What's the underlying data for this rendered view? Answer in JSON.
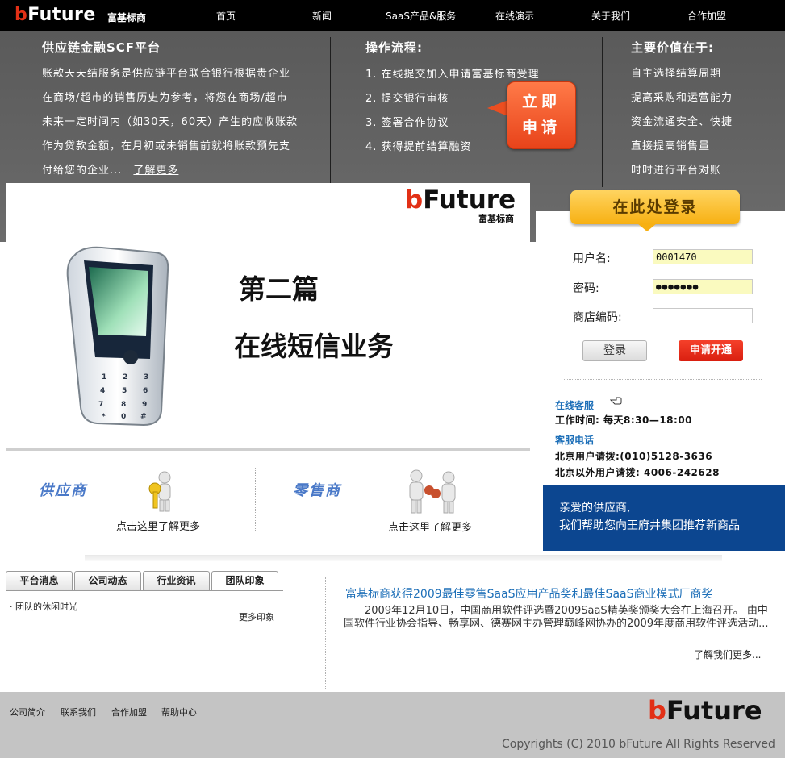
{
  "header": {
    "logo_b": "b",
    "logo_rest": "Future",
    "logo_cn": "富基标商",
    "nav": [
      "首页",
      "新闻",
      "SaaS产品&服务",
      "在线演示",
      "关于我们",
      "合作加盟"
    ]
  },
  "banner": {
    "col1": {
      "title": "供应链金融SCF平台",
      "lines": [
        "账款天天结服务是供应链平台联合银行根据贵企业",
        "在商场/超市的销售历史为参考，将您在商场/超市",
        "未来一定时间内（如30天，60天）产生的应收账款",
        "作为贷款金额，在月初或未销售前就将账款预先支",
        "付给您的企业..."
      ],
      "learn_more": "了解更多"
    },
    "col2": {
      "title": "操作流程:",
      "steps": [
        "1. 在线提交加入申请富基标商受理",
        "2. 提交银行审核",
        "3. 签署合作协议",
        "4. 获得提前结算融资"
      ],
      "apply_button": [
        "立即",
        "申请"
      ]
    },
    "col3": {
      "title": "主要价值在于:",
      "items": [
        "自主选择结算周期",
        "提高采购和运营能力",
        "资金流通安全、快捷",
        "直接提高销售量",
        "时时进行平台对账"
      ]
    }
  },
  "hero": {
    "logo_b": "b",
    "logo_rest": "Future",
    "logo_cn": "富基标商",
    "title1": "第二篇",
    "title2": "在线短信业务"
  },
  "login": {
    "heading": "在此处登录",
    "username_label": "用户名:",
    "username_value": "0001470",
    "password_label": "密码:",
    "password_value": "●●●●●●●",
    "store_label": "商店编码:",
    "store_value": "",
    "login_button": "登录",
    "open_button": "申请开通"
  },
  "service": {
    "online_title": "在线客服",
    "hours": "工作时间: 每天8:30—18:00",
    "phone_title": "客服电话",
    "beijing": "北京用户请拨:(010)5128-3636",
    "outside": "北京以外用户请拨: 4006-242628"
  },
  "promo": {
    "line1": "亲爱的供应商,",
    "line2": "我们帮助您向王府井集团推荐新商品"
  },
  "roles": {
    "supplier": "供应商",
    "supplier_link": "点击这里了解更多",
    "retailer": "零售商",
    "retailer_link": "点击这里了解更多"
  },
  "tabs": {
    "items": [
      "平台消息",
      "公司动态",
      "行业资讯",
      "团队印象"
    ],
    "active": "团队印象",
    "list": [
      "团队的休闲时光"
    ],
    "more": "更多印象"
  },
  "news": {
    "title": "富基标商获得2009最佳零售SaaS应用产品奖和最佳SaaS商业模式厂商奖",
    "body": "2009年12月10日，中国商用软件评选暨2009SaaS精英奖颁奖大会在上海召开。 由中国软件行业协会指导、畅享网、德赛网主办管理巅峰网协办的2009年度商用软件评选活动...",
    "more": "了解我们更多..."
  },
  "footer": {
    "links": [
      "公司简介",
      "联系我们",
      "合作加盟",
      "帮助中心"
    ],
    "logo_b": "b",
    "logo_rest": "Future",
    "copyright": "Copyrights (C) 2010 bFuture All Rights Reserved"
  },
  "colors": {
    "brand_red": "#e23016",
    "banner_grey": "#5f5f5f",
    "link_blue": "#1d6fb8",
    "promo_blue": "#0c4690",
    "login_gold": "#f7b012"
  }
}
